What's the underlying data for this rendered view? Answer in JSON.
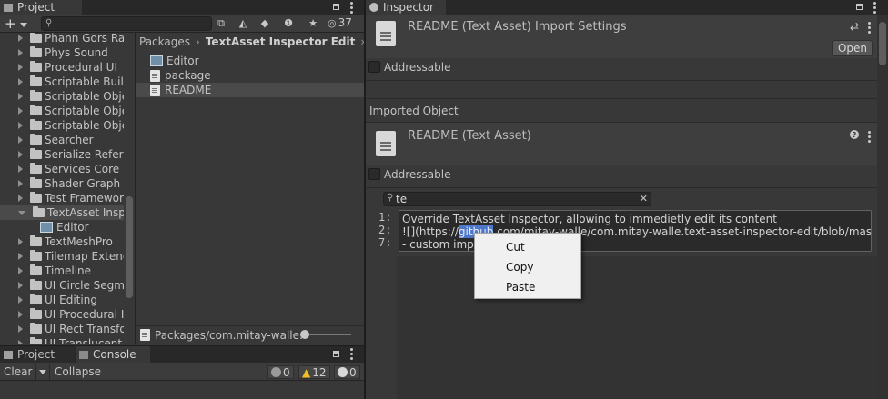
{
  "project_panel": {
    "tab_label": "Project",
    "add_label": "+",
    "search_placeholder": "",
    "hidden_count": "37",
    "tree_items": [
      {
        "label": "Phann Gors Rai",
        "type": "folder",
        "expanded": false
      },
      {
        "label": "Phys Sound",
        "type": "folder",
        "expanded": false
      },
      {
        "label": "Procedural UI",
        "type": "folder",
        "expanded": false
      },
      {
        "label": "Scriptable Build",
        "type": "folder",
        "expanded": false
      },
      {
        "label": "Scriptable Obje",
        "type": "folder",
        "expanded": false
      },
      {
        "label": "Scriptable Obje",
        "type": "folder",
        "expanded": false
      },
      {
        "label": "Scriptable Obje",
        "type": "folder",
        "expanded": false
      },
      {
        "label": "Searcher",
        "type": "folder",
        "expanded": false
      },
      {
        "label": "Serialize Refere",
        "type": "folder",
        "expanded": false
      },
      {
        "label": "Services Core",
        "type": "folder",
        "expanded": false
      },
      {
        "label": "Shader Graph",
        "type": "folder",
        "expanded": false
      },
      {
        "label": "Test Framewor",
        "type": "folder",
        "expanded": false
      },
      {
        "label": "TextAsset Inspe",
        "type": "folder",
        "expanded": true,
        "selected": true
      },
      {
        "label": "Editor",
        "type": "assembly",
        "child": true
      },
      {
        "label": "TextMeshPro",
        "type": "folder",
        "expanded": false
      },
      {
        "label": "Tilemap Extend",
        "type": "folder",
        "expanded": false
      },
      {
        "label": "Timeline",
        "type": "folder",
        "expanded": false
      },
      {
        "label": "UI Circle Segme",
        "type": "folder",
        "expanded": false
      },
      {
        "label": "UI Editing",
        "type": "folder",
        "expanded": false
      },
      {
        "label": "UI Procedural I",
        "type": "folder",
        "expanded": false
      },
      {
        "label": "UI Rect Transfo",
        "type": "folder",
        "expanded": false
      },
      {
        "label": "UI Translucent",
        "type": "folder",
        "expanded": false
      }
    ],
    "breadcrumb": {
      "root": "Packages",
      "current": "TextAsset Inspector Edit"
    },
    "files": [
      {
        "label": "Editor",
        "type": "assembly"
      },
      {
        "label": "package",
        "type": "doc"
      },
      {
        "label": "README",
        "type": "doc",
        "selected": true
      }
    ],
    "footer_path": "Packages/com.mitay-walle."
  },
  "bottom_bar": {
    "project_tab": "Project",
    "console_tab": "Console",
    "clear_label": "Clear",
    "collapse_label": "Collapse",
    "info_count": "0",
    "warning_count": "12",
    "error_count": "0"
  },
  "inspector": {
    "tab_label": "Inspector",
    "header_title": "README (Text Asset) Import Settings",
    "open_label": "Open",
    "addressable_label": "Addressable",
    "imported_object_label": "Imported Object",
    "asset_title": "README (Text Asset)",
    "addressable_label_2": "Addressable",
    "search_value": "te",
    "line_numbers": [
      "1:",
      "2:",
      "7:"
    ],
    "lines": [
      "Override TextAsset Inspector, allowing to immedietly edit its content",
      "![](https://github.com/mitay-walle/com.mitay-walle.text-asset-inspector-edit/blob/master/",
      "- custom impo"
    ],
    "line2_prefix": "![](https://",
    "line2_selected": "github",
    "line2_suffix": ".com/mitay-walle/com.mitay-walle.text-asset-inspector-edit/blob/master/",
    "context_menu": [
      "Cut",
      "Copy",
      "Paste"
    ],
    "colors": {
      "selection": "#4d78cc",
      "panel": "#383838",
      "input_bg": "#2a2a2a"
    }
  }
}
